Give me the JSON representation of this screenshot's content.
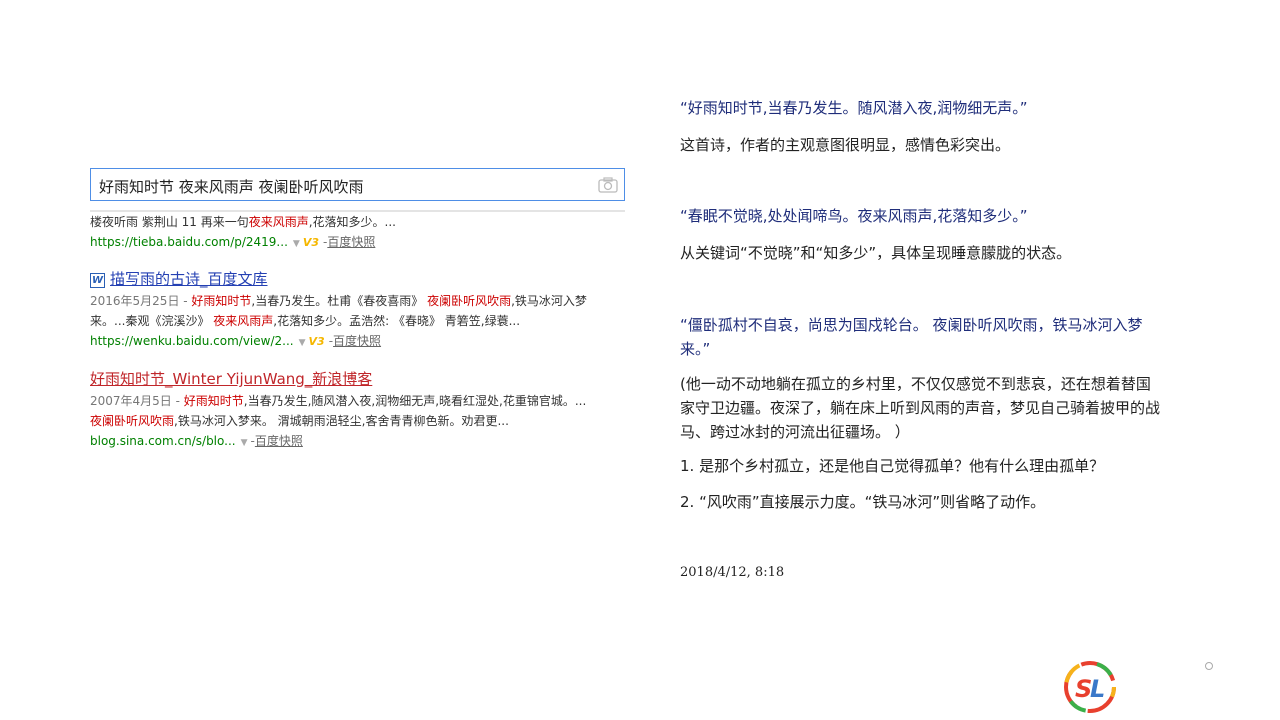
{
  "search": {
    "query": "好雨知时节 夜来风雨声 夜阑卧听风吹雨"
  },
  "results": [
    {
      "snippet": [
        {
          "t": "楼夜听雨 紫荆山 11 再来一句",
          "h": false
        },
        {
          "t": "夜来风雨声",
          "h": true
        },
        {
          "t": ",花落知多少。...",
          "h": false
        }
      ],
      "url": "https://tieba.baidu.com/p/2419...",
      "cache": "百度快照"
    },
    {
      "title": "描写雨的古诗_百度文库",
      "date": "2016年5月25日 - ",
      "snippet1": [
        {
          "t": "好雨知时节",
          "h": true
        },
        {
          "t": ",当春乃发生。杜甫《春夜喜雨》 ",
          "h": false
        },
        {
          "t": "夜阑卧听风吹雨",
          "h": true
        },
        {
          "t": ",铁马冰河入梦",
          "h": false
        }
      ],
      "snippet2": [
        {
          "t": "来。...秦观《浣溪沙》 ",
          "h": false
        },
        {
          "t": "夜来风雨声",
          "h": true
        },
        {
          "t": ",花落知多少。孟浩然: 《春晓》 青箬笠,绿蓑...",
          "h": false
        }
      ],
      "url": "https://wenku.baidu.com/view/2...",
      "cache": "百度快照"
    },
    {
      "title": "好雨知时节_Winter YijunWang_新浪博客",
      "date": "2007年4月5日 - ",
      "snippet1": [
        {
          "t": "好雨知时节",
          "h": true
        },
        {
          "t": ",当春乃发生,随风潜入夜,润物细无声,晓看红湿处,花重锦官城。...",
          "h": false
        }
      ],
      "snippet2": [
        {
          "t": "夜阑卧听风吹雨",
          "h": true
        },
        {
          "t": ",铁马冰河入梦来。 渭城朝雨浥轻尘,客舍青青柳色新。劝君更...",
          "h": false
        }
      ],
      "url": "blog.sina.com.cn/s/blo...",
      "cache": "百度快照"
    }
  ],
  "notes": {
    "q1": "“好雨知时节,当春乃发生。随风潜入夜,润物细无声。”",
    "c1": "这首诗，作者的主观意图很明显，感情色彩突出。",
    "q2": "“春眠不觉晓,处处闻啼鸟。夜来风雨声,花落知多少。”",
    "c2": "从关键词“不觉晓”和“知多少”，具体呈现睡意朦胧的状态。",
    "q3": "“僵卧孤村不自哀，尚思为国戍轮台。 夜阑卧听风吹雨，铁马冰河入梦来。”",
    "c3": "(他一动不动地躺在孤立的乡村里，不仅仅感觉不到悲哀，还在想着替国家守卫边疆。夜深了，躺在床上听到风雨的声音，梦见自己骑着披甲的战马、跨过冰封的河流出征疆场。 ）",
    "p1": "1. 是那个乡村孤立，还是他自己觉得孤单？他有什么理由孤单？",
    "p2": "2. “风吹雨”直接展示力度。“铁马冰河”则省略了动作。",
    "timestamp": "2018/4/12, 8:18"
  },
  "icons": {
    "camera": "camera-icon",
    "wenku": "word-doc-icon",
    "vip": "v3-badge-icon",
    "logo": "sl-logo"
  },
  "colors": {
    "link": "#2440b3",
    "visited": "#c0262a",
    "highlight": "#cc0000",
    "url": "#008000",
    "quote": "#1f2d7a"
  }
}
